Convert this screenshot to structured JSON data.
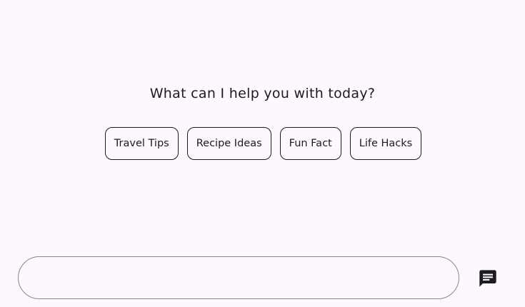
{
  "heading": "What can I help you with today?",
  "suggestions": [
    {
      "label": "Travel Tips"
    },
    {
      "label": "Recipe Ideas"
    },
    {
      "label": "Fun Fact"
    },
    {
      "label": "Life Hacks"
    }
  ],
  "composer": {
    "value": "",
    "placeholder": "",
    "send_icon": "chat-icon"
  },
  "colors": {
    "background": "#fdf8fd",
    "text": "#1c1b1f",
    "outline": "#8a858e"
  }
}
